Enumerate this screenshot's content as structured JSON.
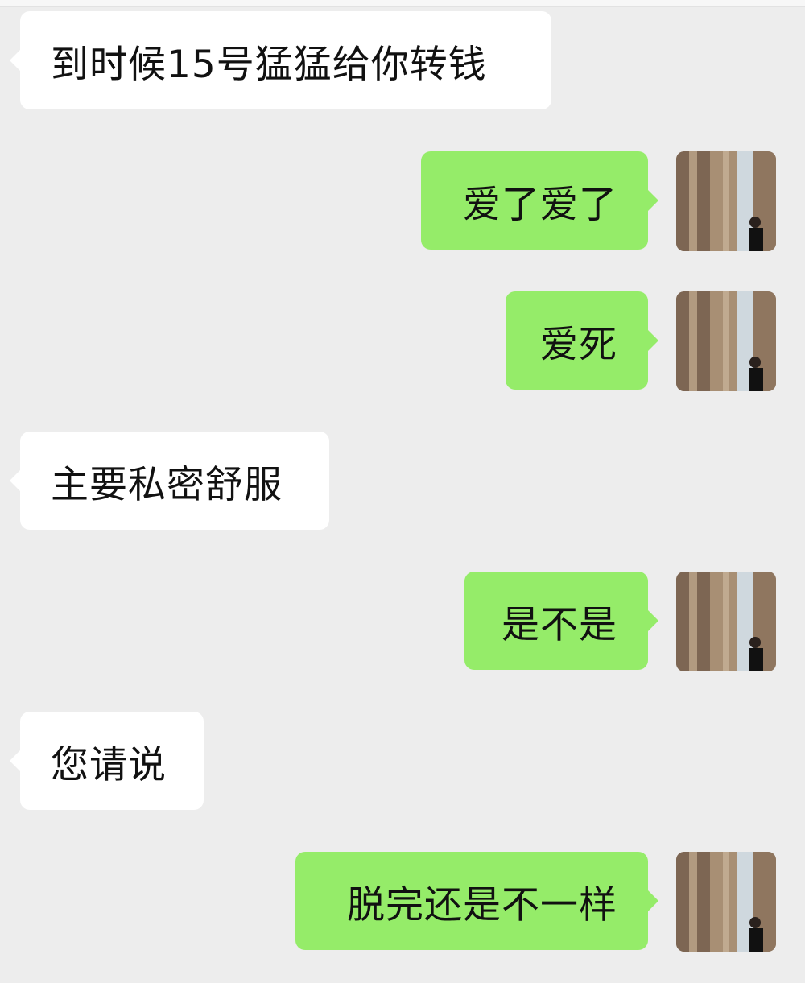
{
  "messages": [
    {
      "direction": "incoming",
      "text": "到时候15号猛猛给你转钱"
    },
    {
      "direction": "outgoing",
      "text": "爱了爱了",
      "avatar": "user-avatar-photo"
    },
    {
      "direction": "outgoing",
      "text": "爱死",
      "avatar": "user-avatar-photo"
    },
    {
      "direction": "incoming",
      "text": "主要私密舒服"
    },
    {
      "direction": "outgoing",
      "text": "是不是",
      "avatar": "user-avatar-photo"
    },
    {
      "direction": "incoming",
      "text": "您请说"
    },
    {
      "direction": "outgoing",
      "text": "脱完还是不一样",
      "avatar": "user-avatar-photo"
    }
  ],
  "colors": {
    "background": "#ededed",
    "incoming_bubble": "#ffffff",
    "outgoing_bubble": "#95ec69",
    "text": "#111111"
  }
}
